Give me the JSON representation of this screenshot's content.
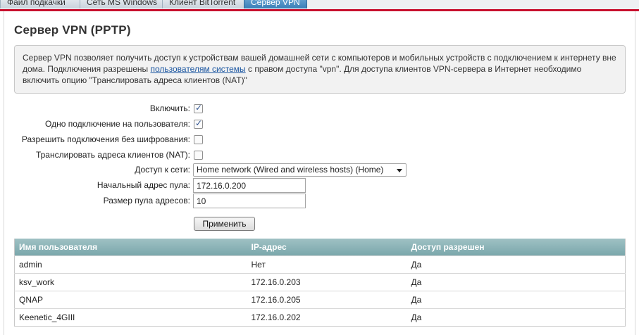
{
  "tabs": [
    {
      "label": "Файл подкачки"
    },
    {
      "label": "Сеть MS Windows"
    },
    {
      "label": "Клиент BitTorrent"
    },
    {
      "label": "Сервер VPN"
    }
  ],
  "page": {
    "title": "Сервер VPN (PPTP)"
  },
  "info": {
    "text_before": "Сервер VPN позволяет получить доступ к устройствам вашей домашней сети с компьютеров и мобильных устройств с подключением к интернету вне дома. Подключения разрешены ",
    "link": "пользователям системы",
    "text_after": " с правом доступа \"vpn\". Для доступа клиентов VPN-сервера в Интернет необходимо включить опцию \"Транслировать адреса клиентов (NAT)\""
  },
  "form": {
    "enable_label": "Включить:",
    "enable_checked": true,
    "single_conn_label": "Одно подключение на пользователя:",
    "single_conn_checked": true,
    "no_encrypt_label": "Разрешить подключения без шифрования:",
    "no_encrypt_checked": false,
    "nat_label": "Транслировать адреса клиентов (NAT):",
    "nat_checked": false,
    "network_label": "Доступ к сети:",
    "network_value": "Home network (Wired and wireless hosts) (Home)",
    "pool_start_label": "Начальный адрес пула:",
    "pool_start_value": "172.16.0.200",
    "pool_size_label": "Размер пула адресов:",
    "pool_size_value": "10",
    "apply_label": "Применить"
  },
  "users_table": {
    "headers": [
      "Имя пользователя",
      "IP-адрес",
      "Доступ разрешен"
    ],
    "rows": [
      [
        "admin",
        "Нет",
        "Да"
      ],
      [
        "ksv_work",
        "172.16.0.203",
        "Да"
      ],
      [
        "QNAP",
        "172.16.0.205",
        "Да"
      ],
      [
        "Keenetic_4GIII",
        "172.16.0.202",
        "Да"
      ]
    ]
  },
  "colors": {
    "accent_red": "#c8102e",
    "active_tab": "#3a7fb8",
    "table_header": "#86adb0"
  },
  "icons": {
    "checkbox_checked": "check-icon",
    "select_arrow": "chevron-down-icon"
  }
}
